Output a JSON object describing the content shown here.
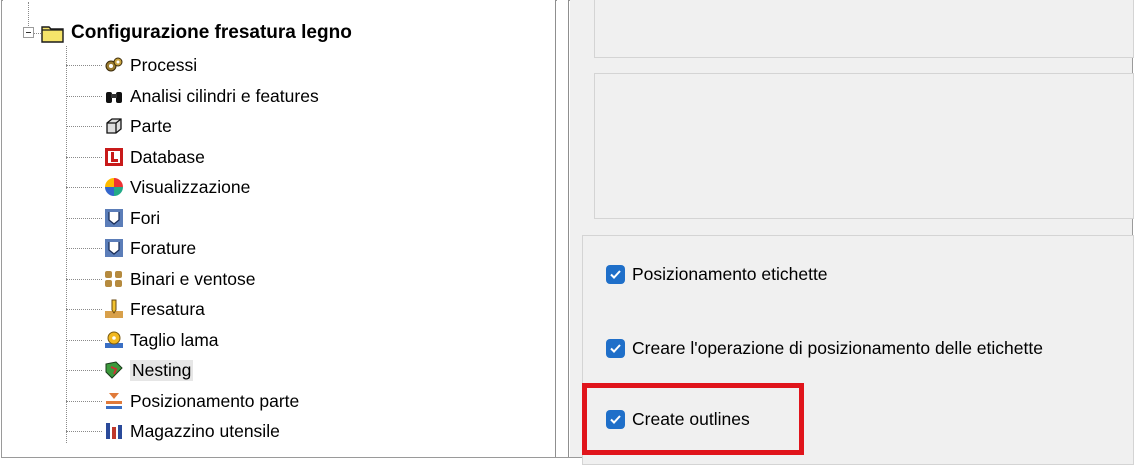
{
  "tree": {
    "root": {
      "label": "Configurazione fresatura legno",
      "icon": "folder-icon"
    },
    "items": [
      {
        "label": "Processi",
        "icon": "gears-icon"
      },
      {
        "label": "Analisi cilindri e features",
        "icon": "binoculars-icon"
      },
      {
        "label": "Parte",
        "icon": "cube-icon"
      },
      {
        "label": "Database",
        "icon": "database-icon"
      },
      {
        "label": "Visualizzazione",
        "icon": "color-wheel-icon"
      },
      {
        "label": "Fori",
        "icon": "hole-icon"
      },
      {
        "label": "Forature",
        "icon": "drilling-icon"
      },
      {
        "label": "Binari e ventose",
        "icon": "rails-suction-icon"
      },
      {
        "label": "Fresatura",
        "icon": "milling-icon"
      },
      {
        "label": "Taglio lama",
        "icon": "saw-blade-icon"
      },
      {
        "label": "Nesting",
        "icon": "nesting-icon"
      },
      {
        "label": "Posizionamento parte",
        "icon": "part-positioning-icon"
      },
      {
        "label": "Magazzino utensile",
        "icon": "tool-magazine-icon"
      }
    ]
  },
  "options": {
    "label_positioning": {
      "label": "Posizionamento etichette",
      "checked": true
    },
    "create_label_operation": {
      "label": "Creare l'operazione di posizionamento delle etichette",
      "checked": true
    },
    "create_outlines": {
      "label": "Create outlines",
      "checked": true
    }
  },
  "colors": {
    "checkbox": "#1f6fc9",
    "highlight": "#e0141b",
    "panel_bg": "#f0f0f0"
  }
}
